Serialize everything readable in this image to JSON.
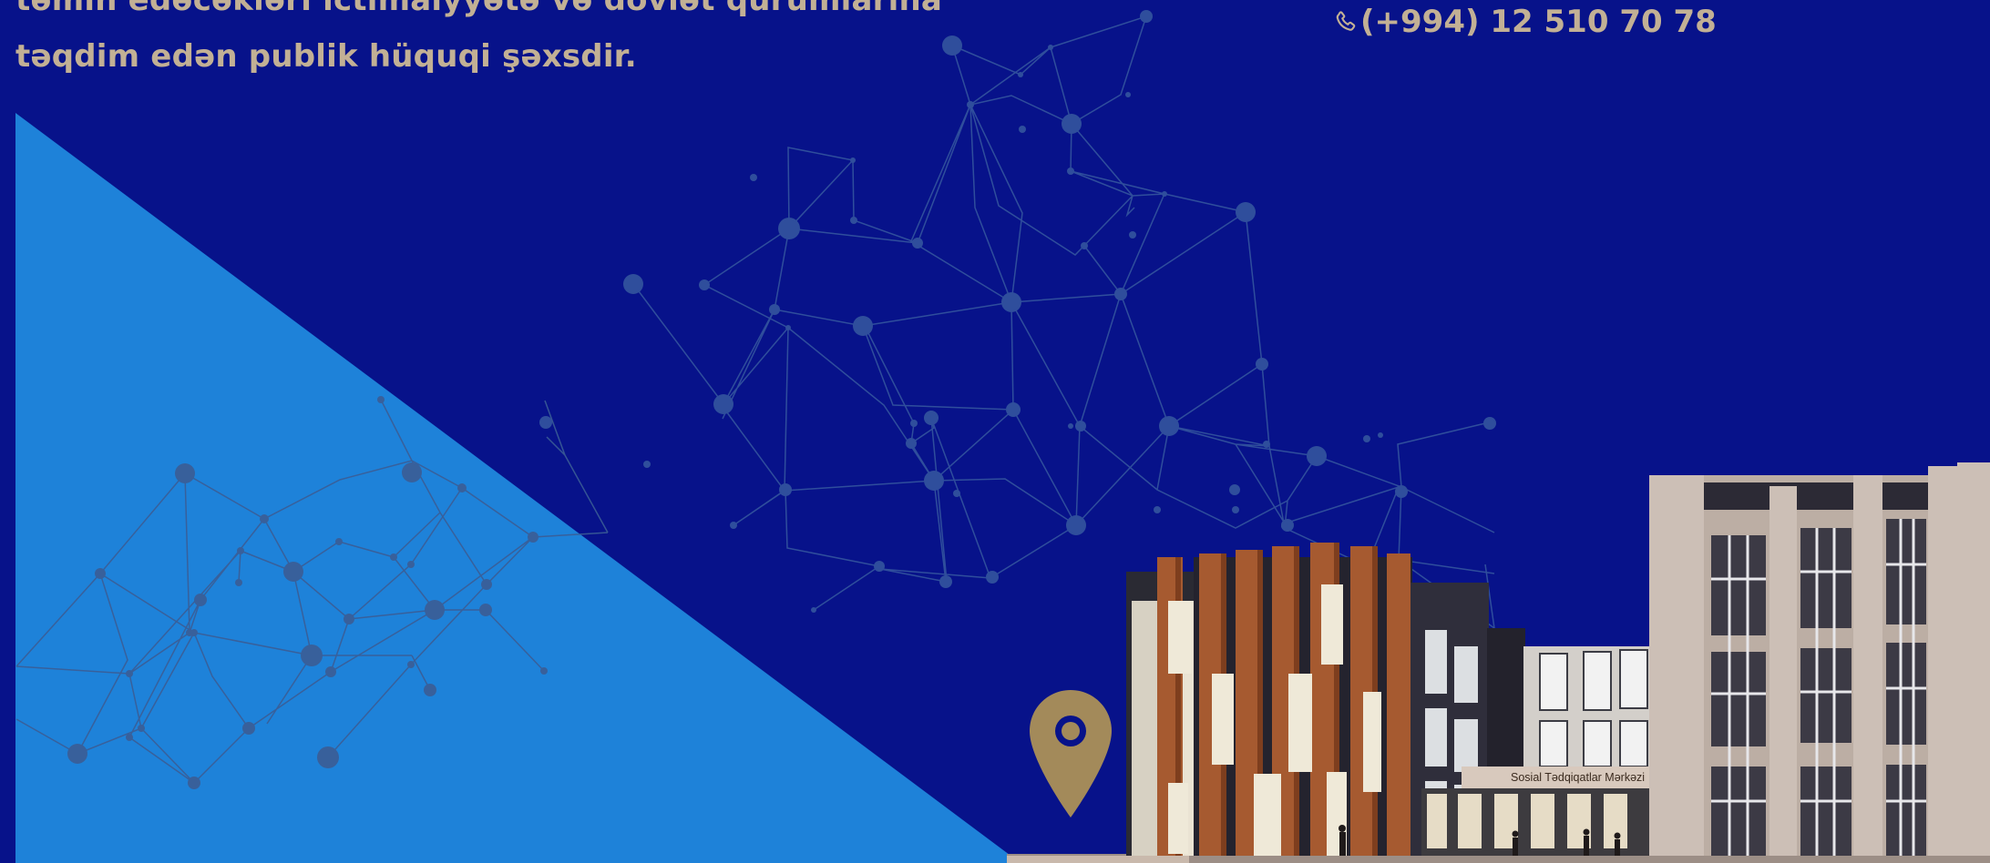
{
  "headline": {
    "line1": "təmin edəcəkləri ictimaiyyətə və dövlət qurumlarına",
    "line2": "təqdim edən publik hüquqi şəxsdir."
  },
  "contact": {
    "phone": "(+994) 12 510 70 78",
    "phone_icon": "phone-icon"
  },
  "building": {
    "sign": "Sosial Tədqiqatlar Mərkəzi"
  },
  "colors": {
    "background": "#07128a",
    "triangle": "#1e82d9",
    "text_gold": "#c2b095",
    "network": "#3d5aa6"
  },
  "icons": [
    "phone-icon",
    "location-pin-icon"
  ]
}
